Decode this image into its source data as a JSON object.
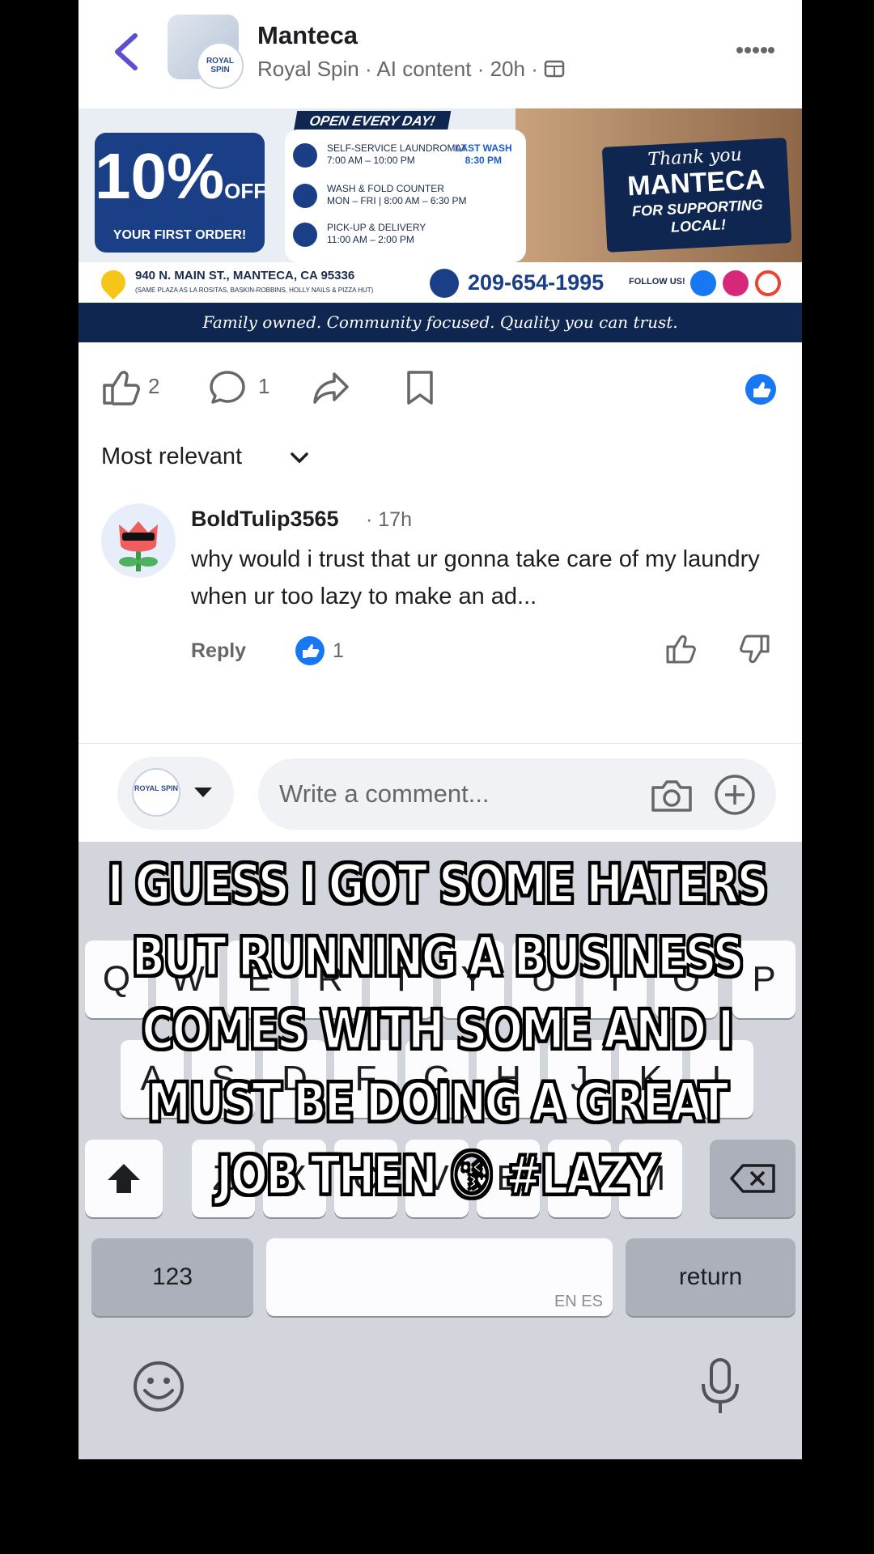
{
  "header": {
    "page_name": "Manteca",
    "sub_line": "Royal Spin · AI content · 20h ·",
    "avatar_text": "ROYAL SPIN"
  },
  "banner": {
    "promo_big": "10%",
    "promo_off": "OFF",
    "promo_small": "YOUR FIRST ORDER!",
    "open_tag": "OPEN EVERY DAY!",
    "hours": [
      {
        "line1": "SELF-SERVICE LAUNDROMAT",
        "line2": "7:00 AM – 10:00 PM"
      },
      {
        "line1": "WASH & FOLD COUNTER",
        "line2": "MON – FRI | 8:00 AM – 6:30 PM"
      },
      {
        "line1": "PICK-UP & DELIVERY",
        "line2": "11:00 AM – 2:00 PM"
      }
    ],
    "last_wash_label": "LAST WASH",
    "last_wash_time": "8:30 PM",
    "thanks_1": "Thank you",
    "thanks_2": "MANTECA",
    "thanks_3": "FOR SUPPORTING LOCAL!",
    "address": "940 N. MAIN ST., MANTECA, CA 95336",
    "address_sub": "(SAME PLAZA AS LA ROSITAS, BASKIN-ROBBINS, HOLLY NAILS & PIZZA HUT)",
    "phone": "209-654-1995",
    "follow": "FOLLOW US!",
    "tagline": "Family owned. Community focused. Quality you can trust."
  },
  "actions": {
    "like_count": "2",
    "comment_count": "1"
  },
  "comments": {
    "sort_label": "Most relevant",
    "items": [
      {
        "author": "BoldTulip3565",
        "time": "· 17h",
        "text": "why would i trust that ur gonna take care of my laundry when ur too lazy to make an ad...",
        "reply_label": "Reply",
        "like_count": "1"
      }
    ]
  },
  "composer": {
    "placeholder": "Write a comment...",
    "avatar_text": "ROYAL SPIN"
  },
  "keyboard": {
    "row1": [
      "Q",
      "W",
      "E",
      "R",
      "T",
      "Y",
      "U",
      "I",
      "O",
      "P"
    ],
    "row2": [
      "A",
      "S",
      "D",
      "F",
      "G",
      "H",
      "J",
      "K",
      "L"
    ],
    "row3": [
      "Z",
      "X",
      "C",
      "V",
      "B",
      "N",
      "M"
    ],
    "numbers_label": "123",
    "return_label": "return",
    "lang_label": "EN ES"
  },
  "caption": "I GUESS I GOT SOME HATERS BUT RUNNING A BUSINESS COMES WITH SOME AND I MUST BE DOING A GREAT JOB THEN 😘 #LAZY",
  "colors": {
    "accent": "#1877f2",
    "brand_navy": "#0f2750",
    "keyboard_bg": "#d2d5db"
  }
}
